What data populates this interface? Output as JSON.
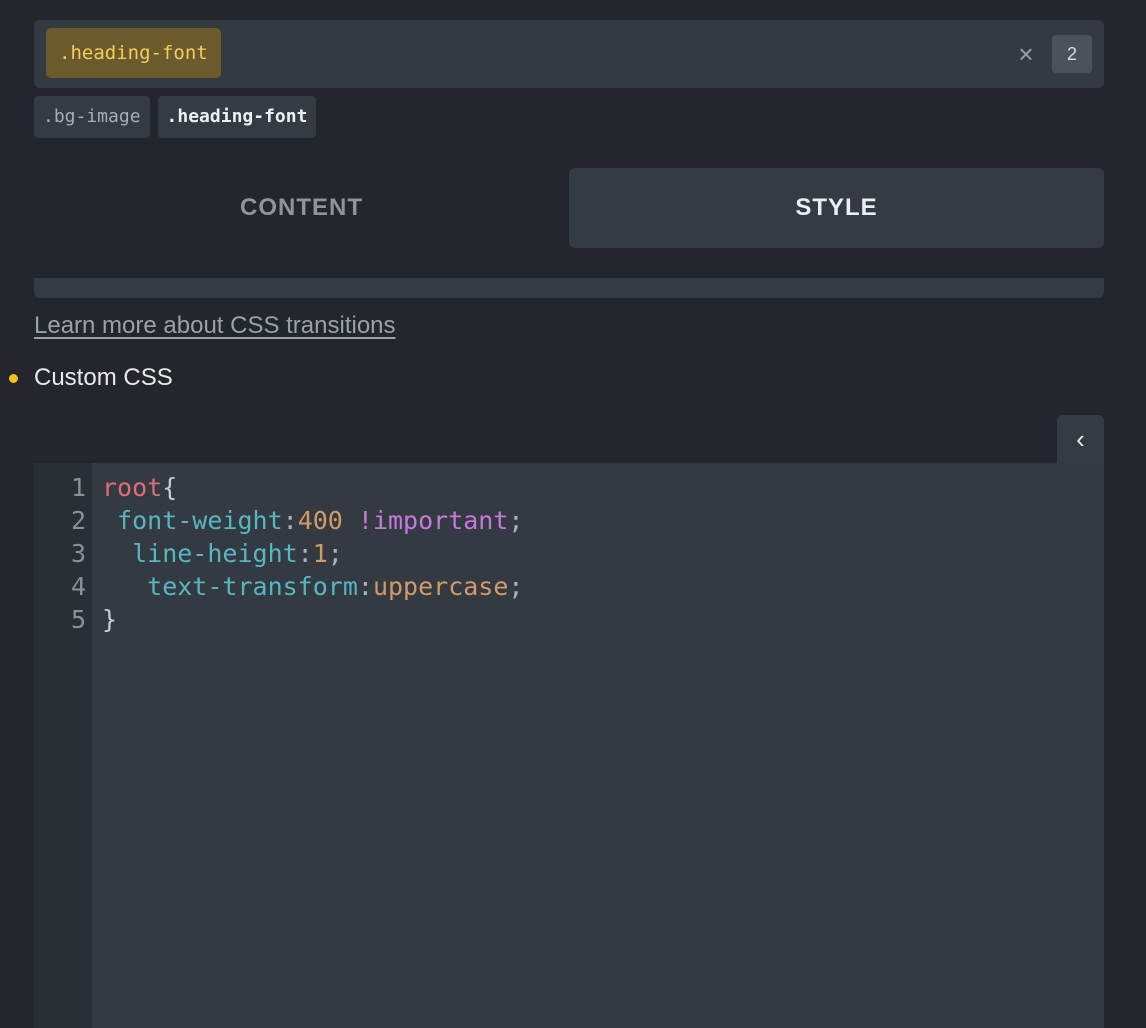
{
  "selector": {
    "active_class": ".heading-font",
    "clear_icon": "close-icon",
    "count": "2",
    "tags": [
      {
        "label": ".bg-image",
        "active": false
      },
      {
        "label": ".heading-font",
        "active": true
      }
    ]
  },
  "tabs": [
    {
      "label": "CONTENT",
      "active": false
    },
    {
      "label": "STYLE",
      "active": true
    }
  ],
  "learn_more_link": "Learn more about CSS transitions",
  "custom_css": {
    "label": "Custom CSS",
    "collapse_icon": "chevron-left-icon",
    "code_lines": [
      {
        "num": "1",
        "tokens": [
          {
            "t": "root",
            "c": "#e06c75"
          },
          {
            "t": "{",
            "c": "#c8ccd4"
          }
        ]
      },
      {
        "num": "2",
        "tokens": [
          {
            "t": " font-weight",
            "c": "#56b6c2"
          },
          {
            "t": ":",
            "c": "#abb2bf"
          },
          {
            "t": "400",
            "c": "#d19a66"
          },
          {
            "t": " !important",
            "c": "#c678dd"
          },
          {
            "t": ";",
            "c": "#abb2bf"
          }
        ]
      },
      {
        "num": "3",
        "tokens": [
          {
            "t": "  line-height",
            "c": "#56b6c2"
          },
          {
            "t": ":",
            "c": "#abb2bf"
          },
          {
            "t": "1",
            "c": "#d19a66"
          },
          {
            "t": ";",
            "c": "#abb2bf"
          }
        ]
      },
      {
        "num": "4",
        "tokens": [
          {
            "t": "   text-transform",
            "c": "#56b6c2"
          },
          {
            "t": ":",
            "c": "#abb2bf"
          },
          {
            "t": "uppercase",
            "c": "#d19a66"
          },
          {
            "t": ";",
            "c": "#abb2bf"
          }
        ]
      },
      {
        "num": "5",
        "tokens": [
          {
            "t": "}",
            "c": "#c8ccd4"
          }
        ]
      }
    ]
  },
  "colors": {
    "accent_yellow": "#f3cf5a",
    "bullet": "#f1c40f"
  }
}
